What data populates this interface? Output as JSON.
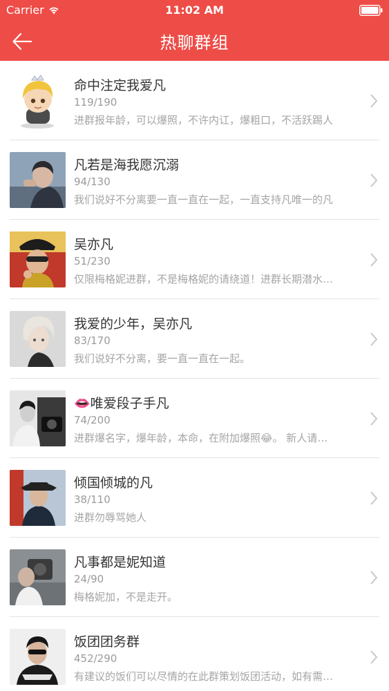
{
  "status_bar": {
    "carrier": "Carrier",
    "time": "11:02 AM"
  },
  "nav": {
    "title": "热聊群组",
    "back_icon": "arrow-left-icon"
  },
  "colors": {
    "header_bg": "#ee4c47",
    "name_text": "#333333",
    "meta_text": "#9b9b9b"
  },
  "groups": [
    {
      "name": "命中注定我爱凡",
      "count": "119/190",
      "desc": "进群报年龄，可以爆照，不许内讧，爆粗口，不活跃踢人"
    },
    {
      "name": "凡若是海我愿沉溺",
      "count": "94/130",
      "desc": "我们说好不分离要一直一直在一起，一直支持凡唯一的凡"
    },
    {
      "name": "吴亦凡",
      "count": "51/230",
      "desc": "仅限梅格妮进群，不是梅格妮的请绕道！进群长期潜水者踢"
    },
    {
      "name": "我爱的少年，吴亦凡",
      "count": "83/170",
      "desc": "我们说好不分离，要一直一直在一起。"
    },
    {
      "name": "👄唯爱段子手凡",
      "count": "74/200",
      "desc": "进群爆名字，爆年龄，本命，在附加爆照😂。 新人请多多关照"
    },
    {
      "name": "倾国倾城的凡",
      "count": "38/110",
      "desc": "进群勿辱骂她人"
    },
    {
      "name": "凡事都是妮知道",
      "count": "24/90",
      "desc": "梅格妮加，不是走开。"
    },
    {
      "name": "饭团团务群",
      "count": "452/290",
      "desc": "有建议的饭们可以尽情的在此群策划饭团活动，如有需要请联系"
    }
  ]
}
